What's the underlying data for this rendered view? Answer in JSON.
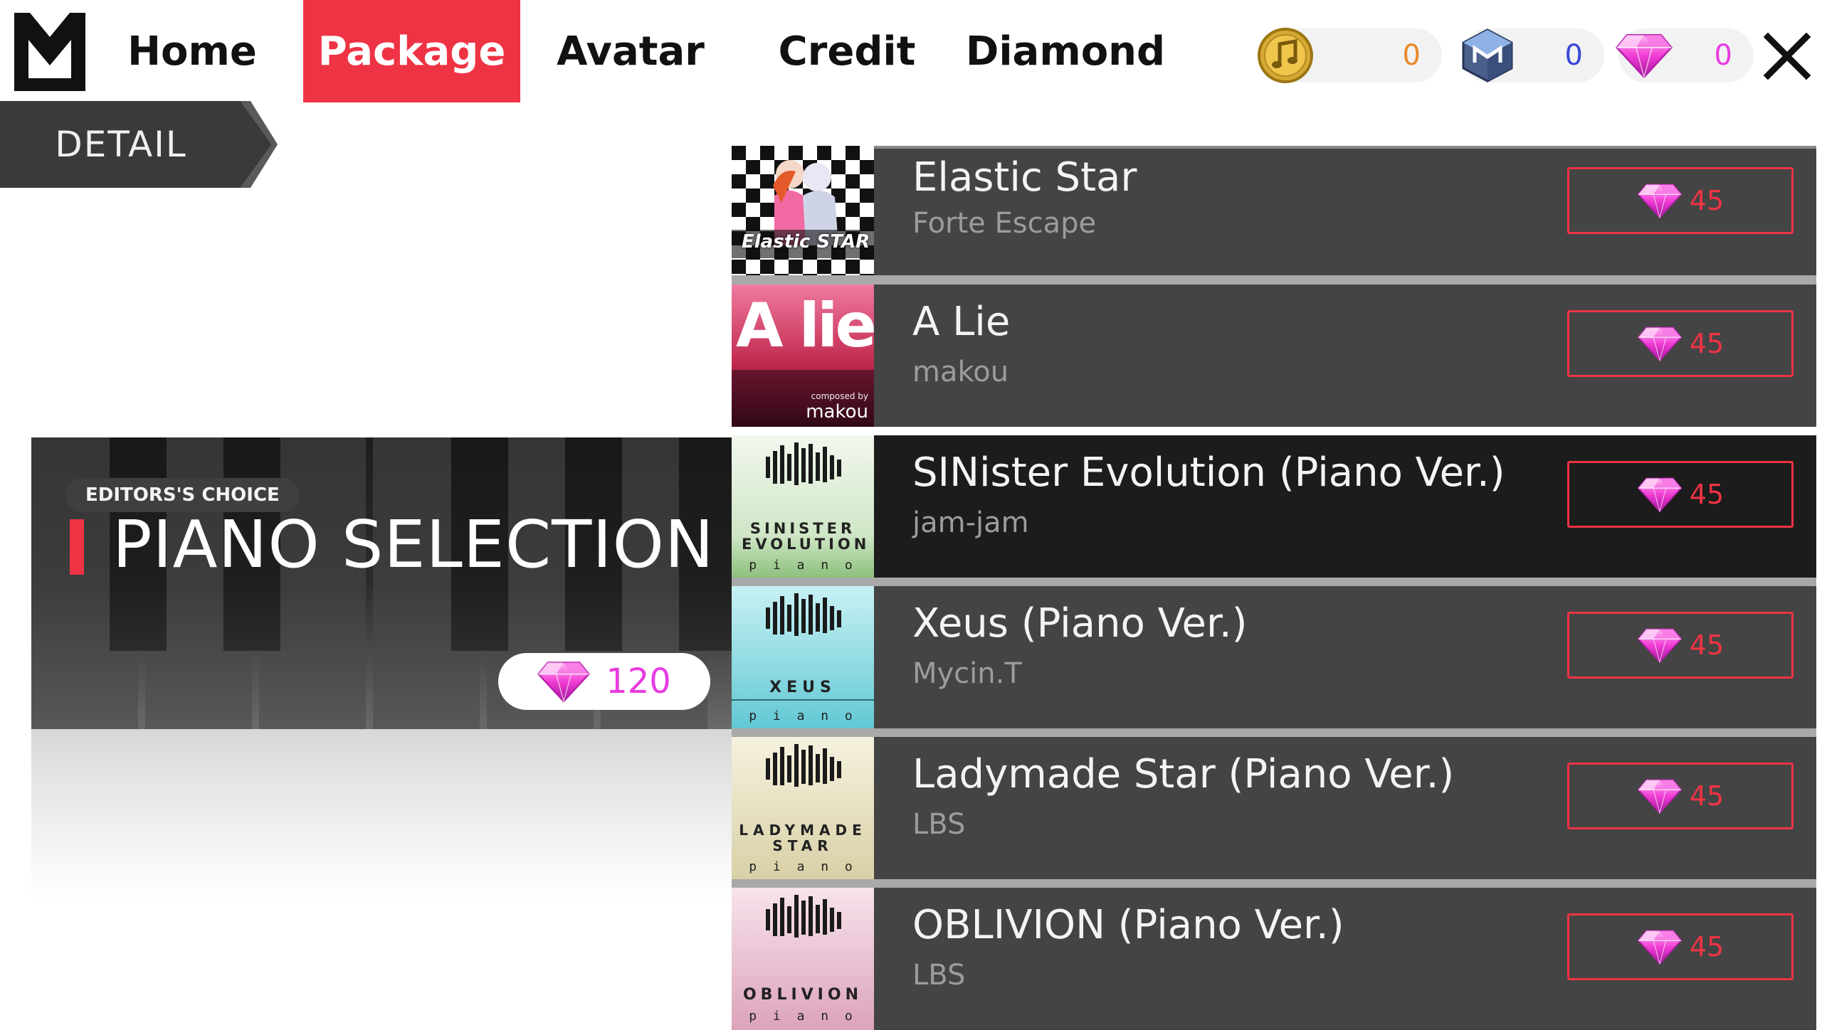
{
  "nav": {
    "tabs": [
      {
        "label": "Home"
      },
      {
        "label": "Package",
        "active": true
      },
      {
        "label": "Avatar"
      },
      {
        "label": "Credit"
      },
      {
        "label": "Diamond"
      }
    ]
  },
  "currencies": [
    {
      "icon": "music-coin-icon",
      "value": "0",
      "color": "#e8892a"
    },
    {
      "icon": "m-cube-icon",
      "value": "0",
      "color": "#3a46d8"
    },
    {
      "icon": "diamond-icon",
      "value": "0",
      "color": "#e83be0"
    }
  ],
  "detail_label": "DETAIL",
  "package": {
    "badge": "EDITORS'S CHOICE",
    "title": "PIANO SELECTION",
    "price": "120",
    "price_color": "#e83be0"
  },
  "songs": [
    {
      "title": "Elastic Star",
      "artist": "Forte Escape",
      "price": "45",
      "jacket_text": "Elastic STAR"
    },
    {
      "title": "A Lie",
      "artist": "makou",
      "price": "45",
      "jacket_text": "A lie",
      "jacket_sub": "makou",
      "jacket_small": "composed by"
    },
    {
      "title": "SINister Evolution (Piano Ver.)",
      "artist": "jam-jam",
      "price": "45",
      "jacket_text": "SINISTER EVOLUTION",
      "jacket_sub": "p i a n o",
      "selected": true
    },
    {
      "title": "Xeus (Piano Ver.)",
      "artist": "Mycin.T",
      "price": "45",
      "jacket_text": "XEUS",
      "jacket_sub": "p i a n o"
    },
    {
      "title": "Ladymade Star (Piano Ver.)",
      "artist": "LBS",
      "price": "45",
      "jacket_text": "LADYMADE STAR",
      "jacket_sub": "p i a n o"
    },
    {
      "title": "OBLIVION (Piano Ver.)",
      "artist": "LBS",
      "price": "45",
      "jacket_text": "OBLIVION",
      "jacket_sub": "p i a n o"
    }
  ],
  "colors": {
    "accent": "#ee3344",
    "row_bg": "#444444",
    "row_selected_bg": "#1c1c1c"
  }
}
